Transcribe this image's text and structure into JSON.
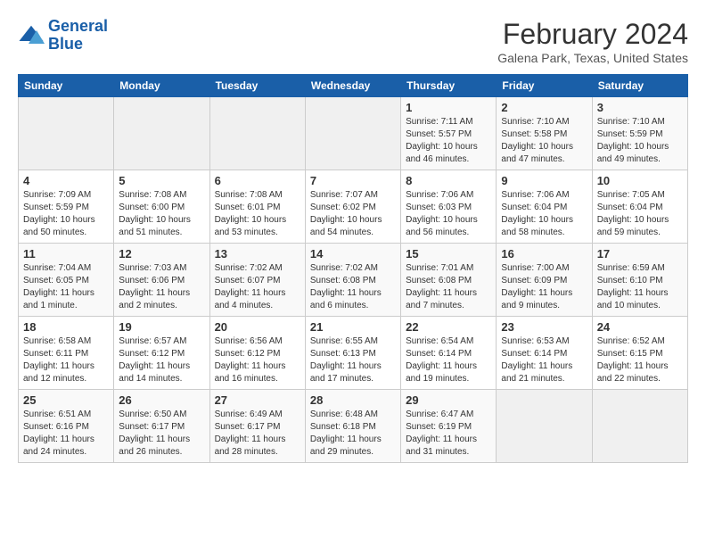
{
  "header": {
    "logo_line1": "General",
    "logo_line2": "Blue",
    "title": "February 2024",
    "subtitle": "Galena Park, Texas, United States"
  },
  "calendar": {
    "days_of_week": [
      "Sunday",
      "Monday",
      "Tuesday",
      "Wednesday",
      "Thursday",
      "Friday",
      "Saturday"
    ],
    "weeks": [
      [
        {
          "day": "",
          "info": ""
        },
        {
          "day": "",
          "info": ""
        },
        {
          "day": "",
          "info": ""
        },
        {
          "day": "",
          "info": ""
        },
        {
          "day": "1",
          "info": "Sunrise: 7:11 AM\nSunset: 5:57 PM\nDaylight: 10 hours and 46 minutes."
        },
        {
          "day": "2",
          "info": "Sunrise: 7:10 AM\nSunset: 5:58 PM\nDaylight: 10 hours and 47 minutes."
        },
        {
          "day": "3",
          "info": "Sunrise: 7:10 AM\nSunset: 5:59 PM\nDaylight: 10 hours and 49 minutes."
        }
      ],
      [
        {
          "day": "4",
          "info": "Sunrise: 7:09 AM\nSunset: 5:59 PM\nDaylight: 10 hours and 50 minutes."
        },
        {
          "day": "5",
          "info": "Sunrise: 7:08 AM\nSunset: 6:00 PM\nDaylight: 10 hours and 51 minutes."
        },
        {
          "day": "6",
          "info": "Sunrise: 7:08 AM\nSunset: 6:01 PM\nDaylight: 10 hours and 53 minutes."
        },
        {
          "day": "7",
          "info": "Sunrise: 7:07 AM\nSunset: 6:02 PM\nDaylight: 10 hours and 54 minutes."
        },
        {
          "day": "8",
          "info": "Sunrise: 7:06 AM\nSunset: 6:03 PM\nDaylight: 10 hours and 56 minutes."
        },
        {
          "day": "9",
          "info": "Sunrise: 7:06 AM\nSunset: 6:04 PM\nDaylight: 10 hours and 58 minutes."
        },
        {
          "day": "10",
          "info": "Sunrise: 7:05 AM\nSunset: 6:04 PM\nDaylight: 10 hours and 59 minutes."
        }
      ],
      [
        {
          "day": "11",
          "info": "Sunrise: 7:04 AM\nSunset: 6:05 PM\nDaylight: 11 hours and 1 minute."
        },
        {
          "day": "12",
          "info": "Sunrise: 7:03 AM\nSunset: 6:06 PM\nDaylight: 11 hours and 2 minutes."
        },
        {
          "day": "13",
          "info": "Sunrise: 7:02 AM\nSunset: 6:07 PM\nDaylight: 11 hours and 4 minutes."
        },
        {
          "day": "14",
          "info": "Sunrise: 7:02 AM\nSunset: 6:08 PM\nDaylight: 11 hours and 6 minutes."
        },
        {
          "day": "15",
          "info": "Sunrise: 7:01 AM\nSunset: 6:08 PM\nDaylight: 11 hours and 7 minutes."
        },
        {
          "day": "16",
          "info": "Sunrise: 7:00 AM\nSunset: 6:09 PM\nDaylight: 11 hours and 9 minutes."
        },
        {
          "day": "17",
          "info": "Sunrise: 6:59 AM\nSunset: 6:10 PM\nDaylight: 11 hours and 10 minutes."
        }
      ],
      [
        {
          "day": "18",
          "info": "Sunrise: 6:58 AM\nSunset: 6:11 PM\nDaylight: 11 hours and 12 minutes."
        },
        {
          "day": "19",
          "info": "Sunrise: 6:57 AM\nSunset: 6:12 PM\nDaylight: 11 hours and 14 minutes."
        },
        {
          "day": "20",
          "info": "Sunrise: 6:56 AM\nSunset: 6:12 PM\nDaylight: 11 hours and 16 minutes."
        },
        {
          "day": "21",
          "info": "Sunrise: 6:55 AM\nSunset: 6:13 PM\nDaylight: 11 hours and 17 minutes."
        },
        {
          "day": "22",
          "info": "Sunrise: 6:54 AM\nSunset: 6:14 PM\nDaylight: 11 hours and 19 minutes."
        },
        {
          "day": "23",
          "info": "Sunrise: 6:53 AM\nSunset: 6:14 PM\nDaylight: 11 hours and 21 minutes."
        },
        {
          "day": "24",
          "info": "Sunrise: 6:52 AM\nSunset: 6:15 PM\nDaylight: 11 hours and 22 minutes."
        }
      ],
      [
        {
          "day": "25",
          "info": "Sunrise: 6:51 AM\nSunset: 6:16 PM\nDaylight: 11 hours and 24 minutes."
        },
        {
          "day": "26",
          "info": "Sunrise: 6:50 AM\nSunset: 6:17 PM\nDaylight: 11 hours and 26 minutes."
        },
        {
          "day": "27",
          "info": "Sunrise: 6:49 AM\nSunset: 6:17 PM\nDaylight: 11 hours and 28 minutes."
        },
        {
          "day": "28",
          "info": "Sunrise: 6:48 AM\nSunset: 6:18 PM\nDaylight: 11 hours and 29 minutes."
        },
        {
          "day": "29",
          "info": "Sunrise: 6:47 AM\nSunset: 6:19 PM\nDaylight: 11 hours and 31 minutes."
        },
        {
          "day": "",
          "info": ""
        },
        {
          "day": "",
          "info": ""
        }
      ]
    ]
  }
}
